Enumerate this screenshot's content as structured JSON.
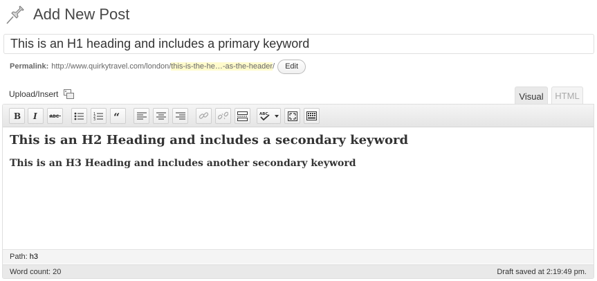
{
  "header": {
    "title": "Add New Post",
    "icon": "pushpin-icon"
  },
  "post": {
    "title_value": "This is an H1 heading and includes a primary keyword"
  },
  "permalink": {
    "label": "Permalink:",
    "base": "http://www.quirkytravel.com/london/",
    "slug": "this-is-the-he…-as-the-header",
    "tail": "/",
    "edit_label": "Edit",
    "slug_highlight_color": "#fffbcc"
  },
  "upload": {
    "label": "Upload/Insert",
    "icon": "media-icon"
  },
  "tabs": {
    "visual": "Visual",
    "html": "HTML"
  },
  "toolbar": {
    "buttons": [
      "bold",
      "italic",
      "strikethrough",
      "bullet-list",
      "numbered-list",
      "blockquote",
      "align-left",
      "align-center",
      "align-right",
      "link",
      "unlink",
      "more-tag",
      "spellcheck",
      "fullscreen",
      "kitchen-sink"
    ]
  },
  "content": {
    "h2": "This is an H2 Heading and includes a secondary keyword",
    "h3": "This is an H3 Heading and includes another secondary keyword"
  },
  "path": {
    "label": "Path:",
    "value": "h3"
  },
  "status": {
    "word_count": "Word count: 20",
    "draft_saved": "Draft saved at 2:19:49 pm."
  }
}
